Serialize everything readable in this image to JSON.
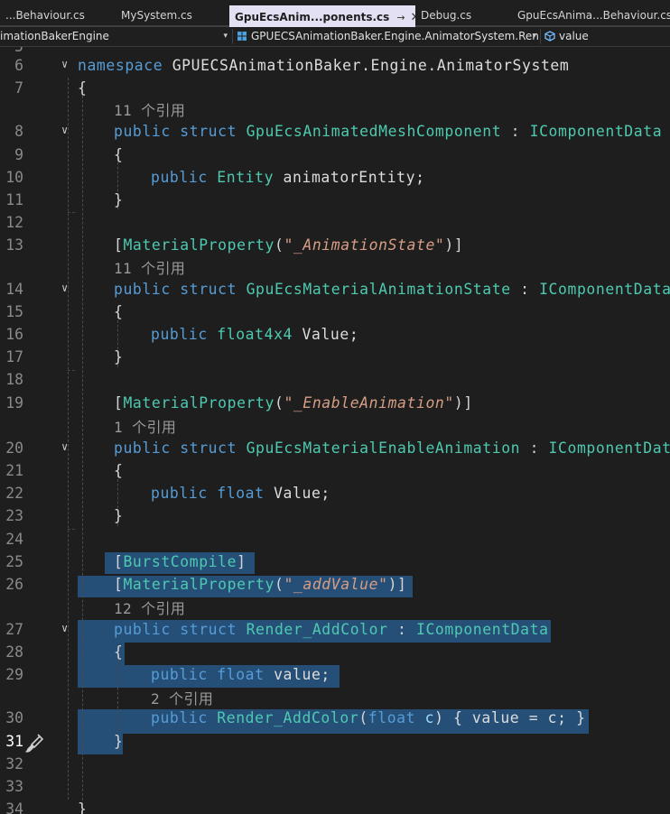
{
  "tabs": [
    {
      "label": "...Behaviour.cs",
      "active": false
    },
    {
      "label": "MySystem.cs",
      "active": false
    },
    {
      "label": "GpuEcsAnim...ponents.cs",
      "active": true,
      "pin": "→",
      "close": "✕"
    },
    {
      "label": "Debug.cs",
      "active": false
    },
    {
      "label": "GpuEcsAnima...Behaviour.cs",
      "active": false
    }
  ],
  "nav": {
    "project": "imationBakerEngine",
    "type_scope": "GPUECSAnimationBaker.Engine.AnimatorSystem.Ren",
    "member": "value",
    "dropdown": "▾"
  },
  "editor": {
    "fold_glyph": "∨",
    "cursor_line": "31",
    "lines": [
      {
        "num": "5",
        "tokens": []
      },
      {
        "num": "6",
        "fold": true,
        "tokens": [
          {
            "t": "namespace ",
            "c": "kw"
          },
          {
            "t": "GPUECSAnimationBaker",
            "c": "id"
          },
          {
            "t": ".",
            "c": "pu"
          },
          {
            "t": "Engine",
            "c": "id"
          },
          {
            "t": ".",
            "c": "pu"
          },
          {
            "t": "AnimatorSystem",
            "c": "id"
          }
        ]
      },
      {
        "num": "7",
        "tokens": [
          {
            "t": "{",
            "c": "pu"
          }
        ]
      },
      {
        "ref": "11 个引用"
      },
      {
        "num": "8",
        "fold": true,
        "tokens": [
          {
            "t": "public ",
            "c": "kw"
          },
          {
            "t": "struct ",
            "c": "kw"
          },
          {
            "t": "GpuEcsAnimatedMeshComponent",
            "c": "ty"
          },
          {
            "t": " : ",
            "c": "pu"
          },
          {
            "t": "IComponentData",
            "c": "ty"
          }
        ]
      },
      {
        "num": "9",
        "tokens": [
          {
            "t": "{",
            "c": "pu"
          }
        ]
      },
      {
        "num": "10",
        "tokens": [
          {
            "t": "public ",
            "c": "kw"
          },
          {
            "t": "Entity",
            "c": "ty"
          },
          {
            "t": " animatorEntity;",
            "c": "id"
          }
        ]
      },
      {
        "num": "11",
        "tokens": [
          {
            "t": "}",
            "c": "pu"
          }
        ]
      },
      {
        "num": "12",
        "tokens": []
      },
      {
        "num": "13",
        "tokens": [
          {
            "t": "[",
            "c": "pu"
          },
          {
            "t": "MaterialProperty",
            "c": "ty"
          },
          {
            "t": "(",
            "c": "pu"
          },
          {
            "t": "\"_AnimationState\"",
            "c": "st"
          },
          {
            "t": ")]",
            "c": "pu"
          }
        ]
      },
      {
        "ref": "11 个引用"
      },
      {
        "num": "14",
        "fold": true,
        "tokens": [
          {
            "t": "public ",
            "c": "kw"
          },
          {
            "t": "struct ",
            "c": "kw"
          },
          {
            "t": "GpuEcsMaterialAnimationState",
            "c": "ty"
          },
          {
            "t": " : ",
            "c": "pu"
          },
          {
            "t": "IComponentData",
            "c": "ty"
          }
        ]
      },
      {
        "num": "15",
        "tokens": [
          {
            "t": "{",
            "c": "pu"
          }
        ]
      },
      {
        "num": "16",
        "tokens": [
          {
            "t": "public ",
            "c": "kw"
          },
          {
            "t": "float4x4",
            "c": "ty"
          },
          {
            "t": " Value;",
            "c": "id"
          }
        ]
      },
      {
        "num": "17",
        "tokens": [
          {
            "t": "}",
            "c": "pu"
          }
        ]
      },
      {
        "num": "18",
        "tokens": []
      },
      {
        "num": "19",
        "tokens": [
          {
            "t": "[",
            "c": "pu"
          },
          {
            "t": "MaterialProperty",
            "c": "ty"
          },
          {
            "t": "(",
            "c": "pu"
          },
          {
            "t": "\"_EnableAnimation\"",
            "c": "st"
          },
          {
            "t": ")]",
            "c": "pu"
          }
        ]
      },
      {
        "ref": "1 个引用"
      },
      {
        "num": "20",
        "fold": true,
        "tokens": [
          {
            "t": "public ",
            "c": "kw"
          },
          {
            "t": "struct ",
            "c": "kw"
          },
          {
            "t": "GpuEcsMaterialEnableAnimation",
            "c": "ty"
          },
          {
            "t": " : ",
            "c": "pu"
          },
          {
            "t": "IComponentData",
            "c": "ty"
          }
        ]
      },
      {
        "num": "21",
        "tokens": [
          {
            "t": "{",
            "c": "pu"
          }
        ]
      },
      {
        "num": "22",
        "tokens": [
          {
            "t": "public ",
            "c": "kw"
          },
          {
            "t": "float",
            "c": "kw"
          },
          {
            "t": " Value;",
            "c": "id"
          }
        ]
      },
      {
        "num": "23",
        "tokens": [
          {
            "t": "}",
            "c": "pu"
          }
        ]
      },
      {
        "num": "24",
        "tokens": []
      },
      {
        "num": "25",
        "tokens": [
          {
            "t": "[",
            "c": "pu"
          },
          {
            "t": "BurstCompile",
            "c": "ty"
          },
          {
            "t": "]",
            "c": "pu"
          }
        ]
      },
      {
        "num": "26",
        "tokens": [
          {
            "t": "[",
            "c": "pu"
          },
          {
            "t": "MaterialProperty",
            "c": "ty"
          },
          {
            "t": "(",
            "c": "pu"
          },
          {
            "t": "\"_addValue\"",
            "c": "st"
          },
          {
            "t": ")]",
            "c": "pu"
          }
        ]
      },
      {
        "ref": "12 个引用"
      },
      {
        "num": "27",
        "fold": true,
        "tokens": [
          {
            "t": "public ",
            "c": "kw"
          },
          {
            "t": "struct ",
            "c": "kw"
          },
          {
            "t": "Render_AddColor",
            "c": "ty"
          },
          {
            "t": " : ",
            "c": "pu"
          },
          {
            "t": "IComponentData",
            "c": "ty"
          }
        ]
      },
      {
        "num": "28",
        "tokens": [
          {
            "t": "{",
            "c": "pu"
          }
        ]
      },
      {
        "num": "29",
        "tokens": [
          {
            "t": "public ",
            "c": "kw"
          },
          {
            "t": "float",
            "c": "kw"
          },
          {
            "t": " value;",
            "c": "id"
          }
        ]
      },
      {
        "ref": "2 个引用"
      },
      {
        "num": "30",
        "tokens": [
          {
            "t": "public ",
            "c": "kw"
          },
          {
            "t": "Render_AddColor",
            "c": "ty"
          },
          {
            "t": "(",
            "c": "pu"
          },
          {
            "t": "float",
            "c": "kw"
          },
          {
            "t": " c",
            "c": "pa"
          },
          {
            "t": ") { value = c; }",
            "c": "id"
          }
        ]
      },
      {
        "num": "31",
        "tokens": [
          {
            "t": "}",
            "c": "pu"
          }
        ]
      },
      {
        "num": "32",
        "tokens": []
      },
      {
        "num": "33",
        "tokens": []
      },
      {
        "num": "34",
        "tokens": [
          {
            "t": "}",
            "c": "pu"
          }
        ]
      }
    ]
  }
}
